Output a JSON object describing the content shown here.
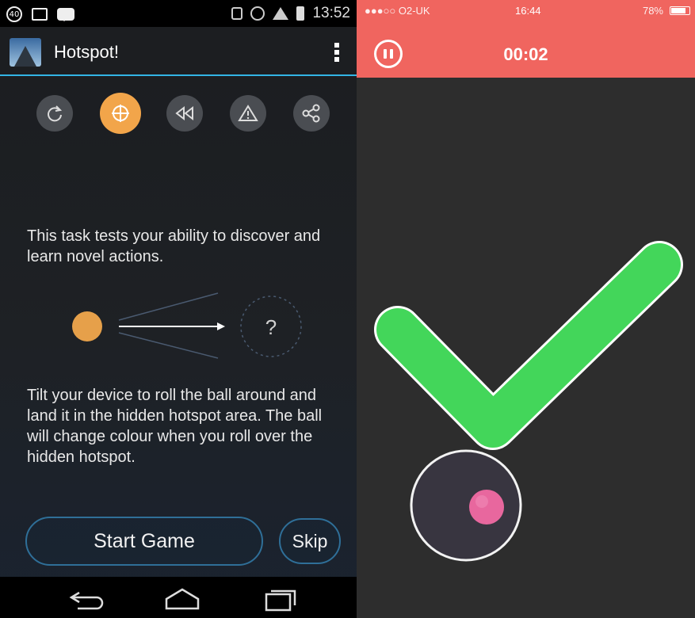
{
  "left_screen": {
    "statusbar": {
      "left_badge": "40",
      "time": "13:52"
    },
    "appbar": {
      "title": "Hotspot!"
    },
    "toolbar_icons": [
      "refresh-icon",
      "target-icon",
      "rewind-icon",
      "warning-icon",
      "share-icon"
    ],
    "instructions_1": "This task tests your ability to discover and learn novel actions.",
    "diagram": {
      "question_mark": "?"
    },
    "instructions_2": "Tilt your device to roll the ball around and land it in the hidden hotspot area. The ball will change colour when you roll over the hidden hotspot.",
    "buttons": {
      "start": "Start Game",
      "skip": "Skip"
    },
    "navbar_icons": [
      "back-icon",
      "home-icon",
      "recents-icon"
    ]
  },
  "right_screen": {
    "statusbar": {
      "carrier": "●●●○○ O2-UK",
      "time": "16:44",
      "battery": "78%"
    },
    "timer": "00:02",
    "colors": {
      "header": "#f0655f",
      "checkmark": "#43d65a",
      "ball": "#e8679e"
    }
  }
}
